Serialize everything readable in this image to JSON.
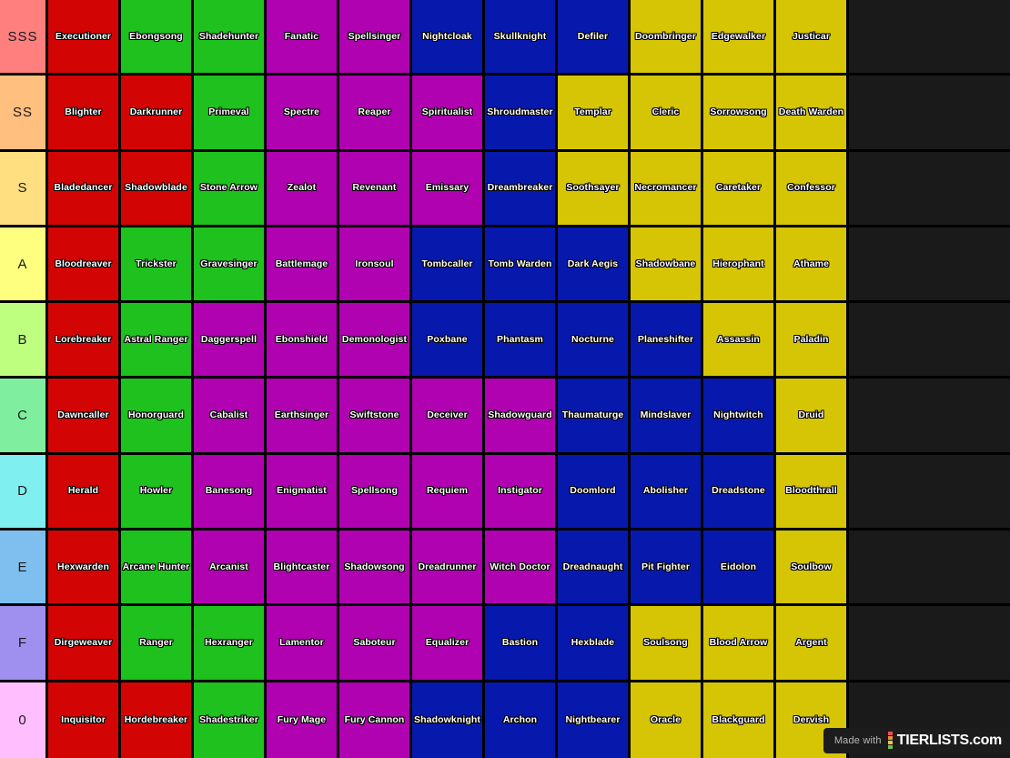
{
  "watermark": {
    "made_with": "Made with",
    "brand": "TIERLISTS",
    "suffix": ".com",
    "bar_colors": [
      "#e8544f",
      "#ef8b3c",
      "#e8c93c",
      "#6fc24a"
    ]
  },
  "palette": {
    "background": "#1a1a1a",
    "gridline": "#000000",
    "red": "#d30404",
    "green": "#1ec11e",
    "purple": "#b002b0",
    "blue": "#0719ac",
    "yellow": "#d6c505"
  },
  "tiers": [
    {
      "label": "SSS",
      "label_color": "#ff7f7f",
      "items": [
        {
          "name": "Executioner",
          "color": "#d30404"
        },
        {
          "name": "Ebongsong",
          "color": "#1ec11e"
        },
        {
          "name": "Shadehunter",
          "color": "#1ec11e"
        },
        {
          "name": "Fanatic",
          "color": "#b002b0"
        },
        {
          "name": "Spellsinger",
          "color": "#b002b0"
        },
        {
          "name": "Nightcloak",
          "color": "#0719ac"
        },
        {
          "name": "Skullknight",
          "color": "#0719ac"
        },
        {
          "name": "Defiler",
          "color": "#0719ac"
        },
        {
          "name": "Doombringer",
          "color": "#d6c505"
        },
        {
          "name": "Edgewalker",
          "color": "#d6c505"
        },
        {
          "name": "Justicar",
          "color": "#d6c505"
        }
      ]
    },
    {
      "label": "SS",
      "label_color": "#ffbf7f",
      "items": [
        {
          "name": "Blighter",
          "color": "#d30404"
        },
        {
          "name": "Darkrunner",
          "color": "#d30404"
        },
        {
          "name": "Primeval",
          "color": "#1ec11e"
        },
        {
          "name": "Spectre",
          "color": "#b002b0"
        },
        {
          "name": "Reaper",
          "color": "#b002b0"
        },
        {
          "name": "Spiritualist",
          "color": "#b002b0"
        },
        {
          "name": "Shroudmaster",
          "color": "#0719ac"
        },
        {
          "name": "Templar",
          "color": "#d6c505"
        },
        {
          "name": "Cleric",
          "color": "#d6c505"
        },
        {
          "name": "Sorrowsong",
          "color": "#d6c505"
        },
        {
          "name": "Death Warden",
          "color": "#d6c505"
        }
      ]
    },
    {
      "label": "S",
      "label_color": "#ffdf7f",
      "items": [
        {
          "name": "Bladedancer",
          "color": "#d30404"
        },
        {
          "name": "Shadowblade",
          "color": "#d30404"
        },
        {
          "name": "Stone Arrow",
          "color": "#1ec11e"
        },
        {
          "name": "Zealot",
          "color": "#b002b0"
        },
        {
          "name": "Revenant",
          "color": "#b002b0"
        },
        {
          "name": "Emissary",
          "color": "#b002b0"
        },
        {
          "name": "Dreambreaker",
          "color": "#0719ac"
        },
        {
          "name": "Soothsayer",
          "color": "#d6c505"
        },
        {
          "name": "Necromancer",
          "color": "#d6c505"
        },
        {
          "name": "Caretaker",
          "color": "#d6c505"
        },
        {
          "name": "Confessor",
          "color": "#d6c505"
        }
      ]
    },
    {
      "label": "A",
      "label_color": "#ffff7f",
      "items": [
        {
          "name": "Bloodreaver",
          "color": "#d30404"
        },
        {
          "name": "Trickster",
          "color": "#1ec11e"
        },
        {
          "name": "Gravesinger",
          "color": "#1ec11e"
        },
        {
          "name": "Battlemage",
          "color": "#b002b0"
        },
        {
          "name": "Ironsoul",
          "color": "#b002b0"
        },
        {
          "name": "Tombcaller",
          "color": "#0719ac"
        },
        {
          "name": "Tomb Warden",
          "color": "#0719ac"
        },
        {
          "name": "Dark Aegis",
          "color": "#0719ac"
        },
        {
          "name": "Shadowbane",
          "color": "#d6c505"
        },
        {
          "name": "Hierophant",
          "color": "#d6c505"
        },
        {
          "name": "Athame",
          "color": "#d6c505"
        }
      ]
    },
    {
      "label": "B",
      "label_color": "#bfff7f",
      "items": [
        {
          "name": "Lorebreaker",
          "color": "#d30404"
        },
        {
          "name": "Astral Ranger",
          "color": "#1ec11e"
        },
        {
          "name": "Daggerspell",
          "color": "#b002b0"
        },
        {
          "name": "Ebonshield",
          "color": "#b002b0"
        },
        {
          "name": "Demonologist",
          "color": "#b002b0"
        },
        {
          "name": "Poxbane",
          "color": "#0719ac"
        },
        {
          "name": "Phantasm",
          "color": "#0719ac"
        },
        {
          "name": "Nocturne",
          "color": "#0719ac"
        },
        {
          "name": "Planeshifter",
          "color": "#0719ac"
        },
        {
          "name": "Assassin",
          "color": "#d6c505"
        },
        {
          "name": "Paladin",
          "color": "#d6c505"
        }
      ]
    },
    {
      "label": "C",
      "label_color": "#7fef9f",
      "items": [
        {
          "name": "Dawncaller",
          "color": "#d30404"
        },
        {
          "name": "Honorguard",
          "color": "#1ec11e"
        },
        {
          "name": "Cabalist",
          "color": "#b002b0"
        },
        {
          "name": "Earthsinger",
          "color": "#b002b0"
        },
        {
          "name": "Swiftstone",
          "color": "#b002b0"
        },
        {
          "name": "Deceiver",
          "color": "#b002b0"
        },
        {
          "name": "Shadowguard",
          "color": "#b002b0"
        },
        {
          "name": "Thaumaturge",
          "color": "#0719ac"
        },
        {
          "name": "Mindslaver",
          "color": "#0719ac"
        },
        {
          "name": "Nightwitch",
          "color": "#0719ac"
        },
        {
          "name": "Druid",
          "color": "#d6c505"
        }
      ]
    },
    {
      "label": "D",
      "label_color": "#7fefef",
      "items": [
        {
          "name": "Herald",
          "color": "#d30404"
        },
        {
          "name": "Howler",
          "color": "#1ec11e"
        },
        {
          "name": "Banesong",
          "color": "#b002b0"
        },
        {
          "name": "Enigmatist",
          "color": "#b002b0"
        },
        {
          "name": "Spellsong",
          "color": "#b002b0"
        },
        {
          "name": "Requiem",
          "color": "#b002b0"
        },
        {
          "name": "Instigator",
          "color": "#b002b0"
        },
        {
          "name": "Doomlord",
          "color": "#0719ac"
        },
        {
          "name": "Abolisher",
          "color": "#0719ac"
        },
        {
          "name": "Dreadstone",
          "color": "#0719ac"
        },
        {
          "name": "Bloodthrall",
          "color": "#d6c505"
        }
      ]
    },
    {
      "label": "E",
      "label_color": "#7fbfef",
      "items": [
        {
          "name": "Hexwarden",
          "color": "#d30404"
        },
        {
          "name": "Arcane Hunter",
          "color": "#1ec11e"
        },
        {
          "name": "Arcanist",
          "color": "#b002b0"
        },
        {
          "name": "Blightcaster",
          "color": "#b002b0"
        },
        {
          "name": "Shadowsong",
          "color": "#b002b0"
        },
        {
          "name": "Dreadrunner",
          "color": "#b002b0"
        },
        {
          "name": "Witch Doctor",
          "color": "#b002b0"
        },
        {
          "name": "Dreadnaught",
          "color": "#0719ac"
        },
        {
          "name": "Pit Fighter",
          "color": "#0719ac"
        },
        {
          "name": "Eidolon",
          "color": "#0719ac"
        },
        {
          "name": "Soulbow",
          "color": "#d6c505"
        }
      ]
    },
    {
      "label": "F",
      "label_color": "#9f8fef",
      "items": [
        {
          "name": "Dirgeweaver",
          "color": "#d30404"
        },
        {
          "name": "Ranger",
          "color": "#1ec11e"
        },
        {
          "name": "Hexranger",
          "color": "#1ec11e"
        },
        {
          "name": "Lamentor",
          "color": "#b002b0"
        },
        {
          "name": "Saboteur",
          "color": "#b002b0"
        },
        {
          "name": "Equalizer",
          "color": "#b002b0"
        },
        {
          "name": "Bastion",
          "color": "#0719ac"
        },
        {
          "name": "Hexblade",
          "color": "#0719ac"
        },
        {
          "name": "Soulsong",
          "color": "#d6c505"
        },
        {
          "name": "Blood Arrow",
          "color": "#d6c505"
        },
        {
          "name": "Argent",
          "color": "#d6c505"
        }
      ]
    },
    {
      "label": "0",
      "label_color": "#ffbfff",
      "items": [
        {
          "name": "Inquisitor",
          "color": "#d30404"
        },
        {
          "name": "Hordebreaker",
          "color": "#d30404"
        },
        {
          "name": "Shadestriker",
          "color": "#1ec11e"
        },
        {
          "name": "Fury Mage",
          "color": "#b002b0"
        },
        {
          "name": "Fury Cannon",
          "color": "#b002b0"
        },
        {
          "name": "Shadowknight",
          "color": "#0719ac"
        },
        {
          "name": "Archon",
          "color": "#0719ac"
        },
        {
          "name": "Nightbearer",
          "color": "#0719ac"
        },
        {
          "name": "Oracle",
          "color": "#d6c505"
        },
        {
          "name": "Blackguard",
          "color": "#d6c505"
        },
        {
          "name": "Dervish",
          "color": "#d6c505"
        }
      ]
    }
  ]
}
